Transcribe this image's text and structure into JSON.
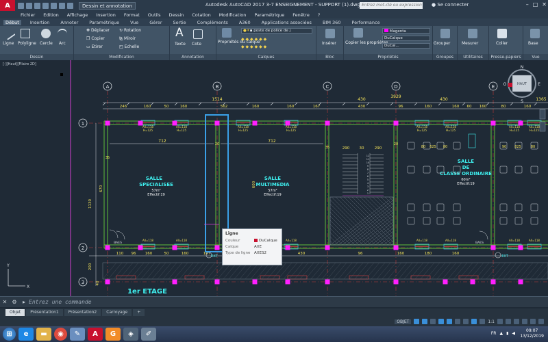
{
  "titlebar": {
    "workspace": "Dessin et annotation",
    "app_title": "Autodesk AutoCAD 2017   3-7 ENSEIGNEMENT - SUPPORT (1).dwg",
    "search_placeholder": "Entrez mot-clé ou expression",
    "signin": "Se connecter"
  },
  "menu": [
    "Fichier",
    "Edition",
    "Affichage",
    "Insertion",
    "Format",
    "Outils",
    "Dessin",
    "Cotation",
    "Modification",
    "Paramétrique",
    "Fenêtre",
    "?"
  ],
  "tabs": [
    "Début",
    "Insertion",
    "Annoter",
    "Paramétrique",
    "Vue",
    "Gérer",
    "Sortie",
    "Compléments",
    "A360",
    "Applications associées",
    "BIM 360",
    "Performance"
  ],
  "ribbon": {
    "draw": {
      "title": "Dessin",
      "line": "Ligne",
      "polyline": "Polyligne",
      "circle": "Cercle",
      "arc": "Arc"
    },
    "modify": {
      "title": "Modification",
      "move": "Déplacer",
      "rotate": "Rotation",
      "copy": "Copier",
      "mirror": "Miroir",
      "stretch": "Etirer",
      "scale": "Echelle"
    },
    "annotation": {
      "title": "Annotation",
      "text": "Texte",
      "dim": "Cote"
    },
    "layers": {
      "title": "Calques",
      "props": "Propriétés du calque",
      "layer_name": "poste de police de j"
    },
    "block": {
      "title": "Bloc",
      "insert": "Insérer"
    },
    "properties": {
      "title": "Propriétés",
      "match": "Copier les propriétés",
      "color": "Magenta",
      "lineweight": "DuCalque",
      "linetype": "DuCal..."
    },
    "groups": {
      "title": "Groupes",
      "group": "Grouper"
    },
    "utilities": {
      "title": "Utilitaires",
      "measure": "Mesurer"
    },
    "clipboard": {
      "title": "Presse-papiers",
      "paste": "Coller"
    },
    "view": {
      "title": "Vue",
      "base": "Base"
    }
  },
  "viewport_label": "[-][Haut][Filaire 2D]",
  "drawing": {
    "grid_labels": [
      "A",
      "B",
      "C",
      "D",
      "E"
    ],
    "row_labels": [
      "1",
      "2",
      "3"
    ],
    "top_dims": [
      "1514",
      "430",
      "3929",
      "430",
      "1365"
    ],
    "dims_row2": [
      "246",
      "160",
      "50",
      "160",
      "562",
      "160",
      "160",
      "167",
      "430",
      "96",
      "160",
      "160",
      "60",
      "160",
      "80",
      "160"
    ],
    "dims_row3": [
      "110",
      "96",
      "160",
      "50",
      "160",
      "167",
      "160",
      "172",
      "430",
      "96",
      "160",
      "180",
      "160"
    ],
    "inner_dims": [
      "712",
      "712",
      "290",
      "30",
      "290"
    ],
    "side_dims": [
      "35",
      "20",
      "35",
      "20",
      "670",
      "600",
      "1130",
      "200",
      "40"
    ],
    "window_labels": [
      "All=118",
      "H=125"
    ],
    "stair_steps": [
      "12",
      "11",
      "10",
      "9",
      "8",
      "7",
      "6",
      "5",
      "4",
      "3",
      "2",
      "1"
    ],
    "rooms": [
      {
        "name1": "SALLE",
        "name2": "SPECIALISEE",
        "area": "57m²",
        "eff": "Effectif:19"
      },
      {
        "name1": "SALLE",
        "name2": "MULTIMEDIA",
        "area": "57m²",
        "eff": "Effectif:19"
      },
      {
        "name1": "SALLE",
        "name2": "DE",
        "name3": "CLASSE ORDINAIRE",
        "area": "60m²",
        "eff": "Effectif:19"
      }
    ],
    "desk_dims": [
      "80",
      "625",
      "80",
      "90",
      "825",
      "80"
    ],
    "labels": {
      "exit": "EXT",
      "baes": "BAES",
      "floor": "1er ETAGE"
    }
  },
  "viewcube": {
    "top": "HAUT",
    "n": "N",
    "s": "S",
    "e": "E",
    "w": "O"
  },
  "tooltip": {
    "title": "Ligne",
    "rows": [
      {
        "k": "Couleur",
        "v": "DuCalque"
      },
      {
        "k": "Calque",
        "v": "AXE"
      },
      {
        "k": "Type de ligne",
        "v": "AXES2"
      }
    ]
  },
  "command_placeholder": "Entrez une commande",
  "layout_tabs": [
    "Objet",
    "Présentation1",
    "Présentation2",
    "Carroyage",
    "+"
  ],
  "status": {
    "model": "OBJET",
    "scale": "1:1"
  },
  "tray": {
    "lang": "FR"
  },
  "clock": {
    "time": "09:07",
    "date": "13/12/2019"
  }
}
